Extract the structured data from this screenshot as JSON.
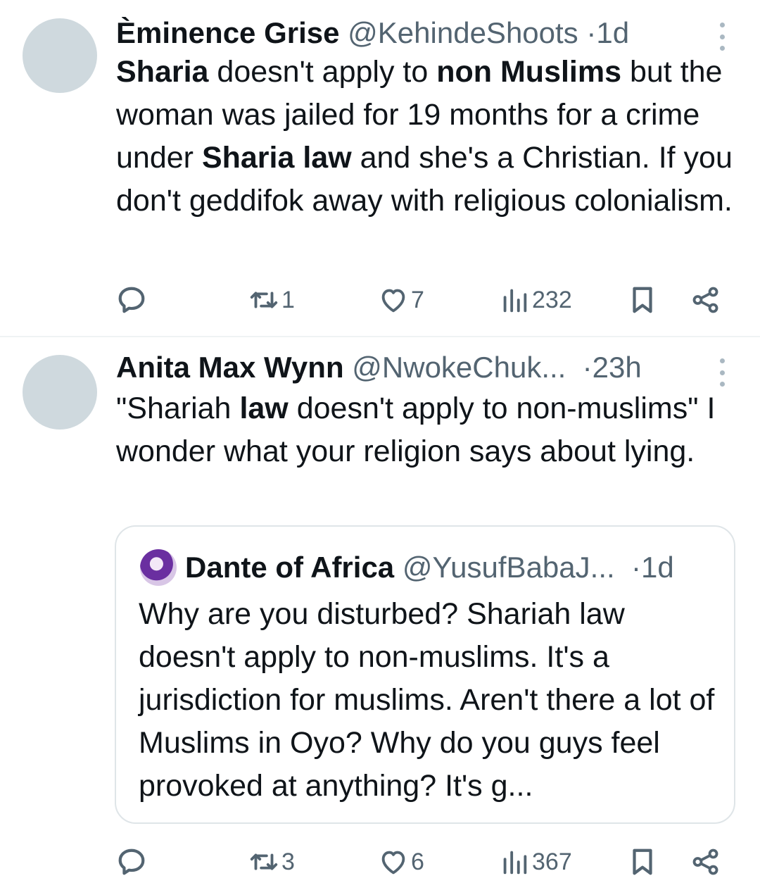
{
  "tweets": [
    {
      "name": "Èminence Grise",
      "handle": "@KehindeShoots",
      "time": "1d",
      "text": [
        {
          "t": "Sharia",
          "b": true
        },
        {
          "t": " doesn't apply to ",
          "b": false
        },
        {
          "t": "non Muslims",
          "b": true
        },
        {
          "t": " but the woman was jailed for 19 months for a crime under ",
          "b": false
        },
        {
          "t": "Sharia law",
          "b": true
        },
        {
          "t": " and she's a Christian. If you don't geddifok away with religious colonialism.",
          "b": false
        }
      ],
      "replies": "",
      "reposts": "1",
      "likes": "7",
      "views": "232"
    },
    {
      "name": "Anita Max Wynn",
      "handle": "@NwokeChuk...",
      "time": "23h",
      "text": [
        {
          "t": "\"Shariah ",
          "b": false
        },
        {
          "t": "law",
          "b": true
        },
        {
          "t": " doesn't apply to non-muslims\" I wonder what your religion says about lying.",
          "b": false
        }
      ],
      "quote": {
        "name": "Dante of Africa",
        "handle": "@YusufBabaJ...",
        "time": "1d",
        "text": "Why are you disturbed? Shariah law doesn't apply to non-muslims. It's a jurisdiction for muslims. Aren't there a lot of Muslims in Oyo? Why do you guys feel provoked at anything? It's g..."
      },
      "replies": "",
      "reposts": "3",
      "likes": "6",
      "views": "367"
    }
  ],
  "icons": {
    "reply": "reply-icon",
    "repost": "repost-icon",
    "like": "heart-icon",
    "views": "views-icon",
    "bookmark": "bookmark-icon",
    "share": "share-icon",
    "more": "more-icon"
  },
  "colors": {
    "text": "#0f1419",
    "muted": "#536471",
    "avatar": "#cfd9de",
    "border": "#dfe5e8"
  }
}
